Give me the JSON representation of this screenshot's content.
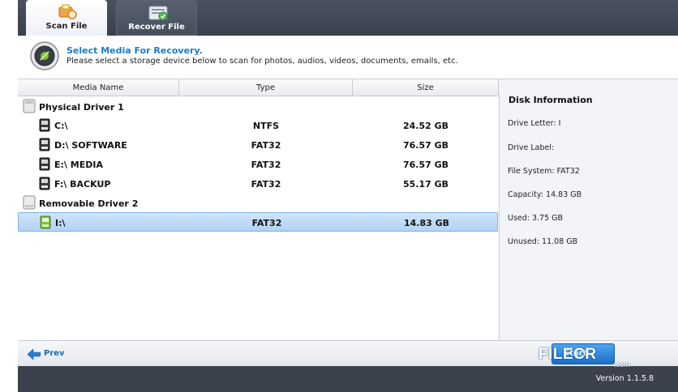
{
  "tabs": [
    {
      "label": "Scan File",
      "icon": "scan-icon",
      "active": true
    },
    {
      "label": "Recover File",
      "icon": "recover-icon",
      "active": false
    }
  ],
  "header": {
    "title": "Select Media For Recovery.",
    "subtitle": "Please select a storage device below to scan for photos, audios, videos, documents, emails, etc.",
    "icon": "magnifier-disk-icon"
  },
  "columns": {
    "name": "Media Name",
    "type": "Type",
    "size": "Size"
  },
  "groups": [
    {
      "label": "Physical Driver 1",
      "icon": "hard-disk-icon",
      "drives": [
        {
          "name": "C:\\",
          "type": "NTFS",
          "size": "24.52 GB"
        },
        {
          "name": "D:\\ SOFTWARE",
          "type": "FAT32",
          "size": "76.57 GB"
        },
        {
          "name": "E:\\ MEDIA",
          "type": "FAT32",
          "size": "76.57 GB"
        },
        {
          "name": "F:\\ BACKUP",
          "type": "FAT32",
          "size": "55.17 GB"
        }
      ]
    },
    {
      "label": "Removable Driver 2",
      "icon": "removable-disk-icon",
      "drives": [
        {
          "name": "I:\\",
          "type": "FAT32",
          "size": "14.83 GB",
          "selected": true
        }
      ]
    }
  ],
  "disk_info": {
    "title": "Disk Information",
    "drive_letter": "Drive Letter: I",
    "drive_label": "Drive Label:",
    "file_system": "File System: FAT32",
    "capacity": "Capacity: 14.83 GB",
    "used": "Used: 3.75 GB",
    "unused": "Unused: 11.08 GB"
  },
  "footer": {
    "prev_label": "Prev",
    "start_label": "Start",
    "watermark": "FILECR",
    "watermark_sub": ".com"
  },
  "status": {
    "version": "Version 1.1.5.8"
  },
  "colors": {
    "accent": "#1e7bc4",
    "selection": "#b3d3f5",
    "frame": "#3c4350"
  }
}
